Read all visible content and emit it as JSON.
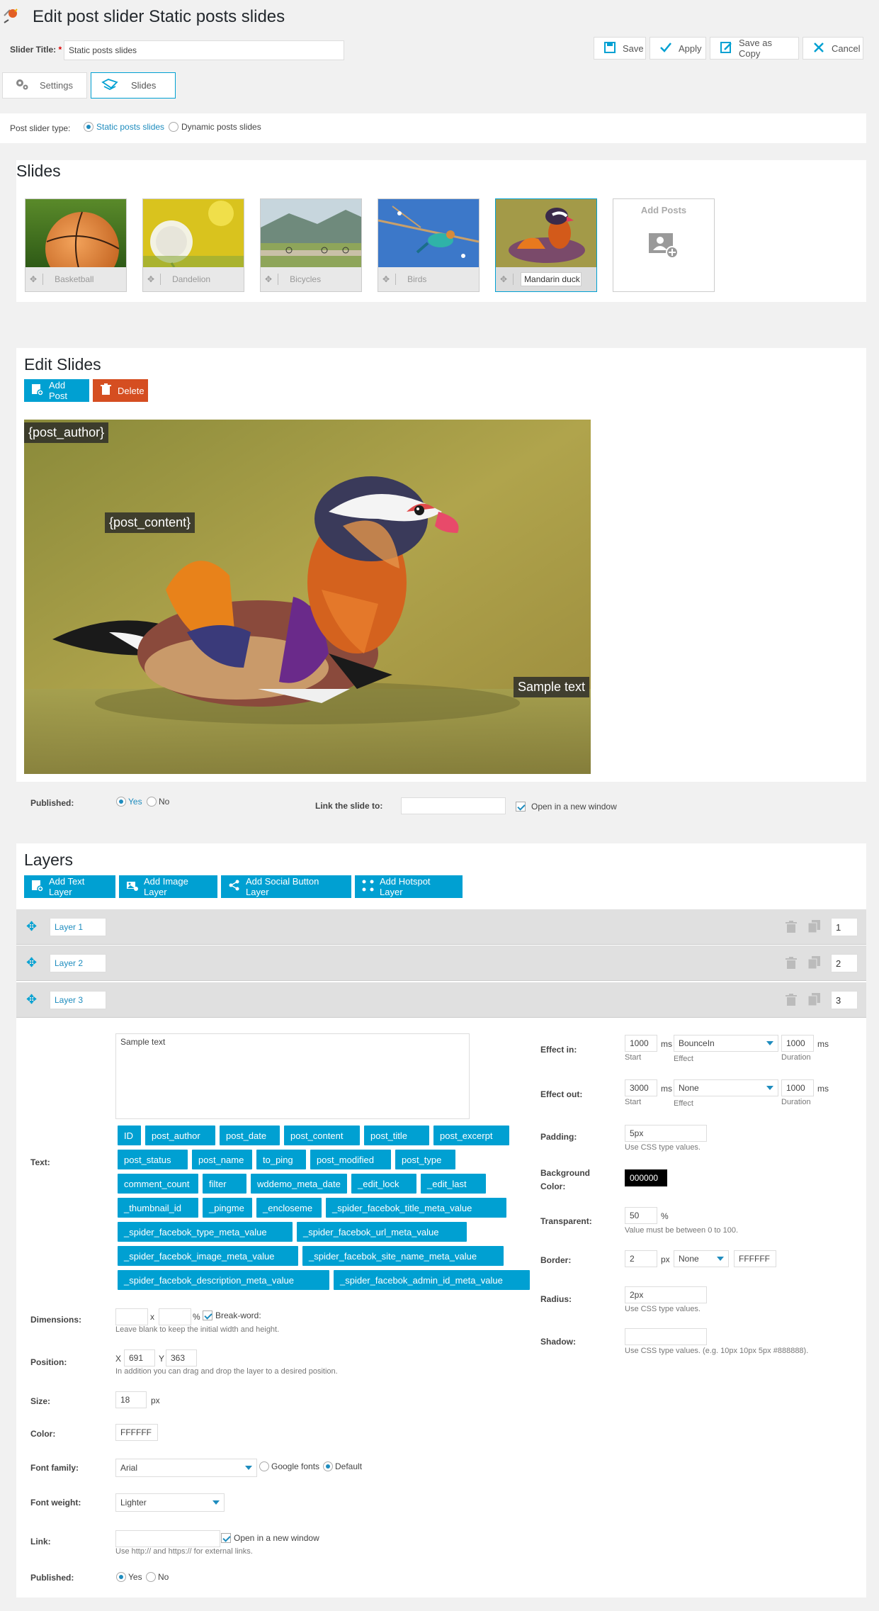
{
  "header": {
    "title": "Edit post slider Static posts slides",
    "slider_title_label": "Slider Title:",
    "required_mark": "*",
    "slider_title_value": "Static posts slides",
    "actions": {
      "save": "Save",
      "apply": "Apply",
      "save_as_copy": "Save as Copy",
      "cancel": "Cancel"
    }
  },
  "tabs": [
    {
      "label": "Settings",
      "active": false
    },
    {
      "label": "Slides",
      "active": true
    }
  ],
  "post_slider_type": {
    "label": "Post slider type:",
    "options": [
      {
        "label": "Static posts slides",
        "selected": true
      },
      {
        "label": "Dynamic posts slides",
        "selected": false
      }
    ]
  },
  "slides": {
    "heading": "Slides",
    "items": [
      {
        "title": "Basketball",
        "icon": "basketball-image",
        "active": false
      },
      {
        "title": "Dandelion",
        "icon": "dandelion-image",
        "active": false
      },
      {
        "title": "Bicycles",
        "icon": "bicycles-image",
        "active": false
      },
      {
        "title": "Birds",
        "icon": "birds-image",
        "active": false
      },
      {
        "title": "Mandarin duck",
        "icon": "duck-image",
        "active": true
      }
    ],
    "add_posts_label": "Add Posts"
  },
  "edit_slides": {
    "heading": "Edit Slides",
    "add_post_label": "Add Post",
    "delete_label": "Delete",
    "overlays": {
      "author": "{post_author}",
      "content": "{post_content}",
      "sample": "Sample text"
    },
    "published_label": "Published:",
    "yes": "Yes",
    "no": "No",
    "published": "Yes",
    "link_label": "Link the slide to:",
    "link_value": "",
    "open_new_window": "Open in a new window",
    "open_new_window_checked": true
  },
  "layers": {
    "heading": "Layers",
    "buttons": {
      "add_text": "Add Text Layer",
      "add_image": "Add Image Layer",
      "add_social": "Add Social Button Layer",
      "add_hotspot": "Add Hotspot Layer"
    },
    "list": [
      {
        "name": "Layer 1",
        "order": "1"
      },
      {
        "name": "Layer 2",
        "order": "2"
      },
      {
        "name": "Layer 3",
        "order": "3"
      }
    ]
  },
  "layer_form": {
    "text_label": "Text:",
    "text_value": "Sample text",
    "placeholder_tags": [
      "ID",
      "post_author",
      "post_date",
      "post_content",
      "post_title",
      "post_excerpt",
      "post_status",
      "post_name",
      "to_ping",
      "post_modified",
      "post_type",
      "comment_count",
      "filter",
      "wddemo_meta_date",
      "_edit_lock",
      "_edit_last",
      "_thumbnail_id",
      "_pingme",
      "_encloseme",
      "_spider_facebok_title_meta_value",
      "_spider_facebok_type_meta_value",
      "_spider_facebok_url_meta_value",
      "_spider_facebok_image_meta_value",
      "_spider_facebok_site_name_meta_value",
      "_spider_facebok_description_meta_value",
      "_spider_facebok_admin_id_meta_value"
    ],
    "dimensions_label": "Dimensions:",
    "dimensions_x_sep": "x",
    "dimensions_unit": "%",
    "break_word_label": "Break-word:",
    "break_word_checked": true,
    "dimensions_hint": "Leave blank to keep the initial width and height.",
    "position_label": "Position:",
    "pos_x_label": "X",
    "pos_x": "691",
    "pos_y_label": "Y",
    "pos_y": "363",
    "position_hint": "In addition you can drag and drop the layer to a desired position.",
    "size_label": "Size:",
    "size_value": "18",
    "size_unit": "px",
    "color_label": "Color:",
    "color_value": "FFFFFF",
    "font_family_label": "Font family:",
    "font_family_value": "Arial",
    "google_fonts_label": "Google fonts",
    "default_label": "Default",
    "font_source": "Default",
    "font_weight_label": "Font weight:",
    "font_weight_value": "Lighter",
    "link_label": "Link:",
    "link_value": "",
    "link_open_new_window": "Open in a new window",
    "link_open_checked": true,
    "link_hint": "Use http:// and https:// for external links.",
    "published_label": "Published:",
    "yes": "Yes",
    "no": "No",
    "published": "Yes",
    "effect_in_label": "Effect in:",
    "effect_in_start": "1000",
    "effect_in_effect": "BounceIn",
    "effect_in_duration": "1000",
    "effect_out_label": "Effect out:",
    "effect_out_start": "3000",
    "effect_out_effect": "None",
    "effect_out_duration": "1000",
    "ms": "ms",
    "start_caption": "Start",
    "effect_caption": "Effect",
    "duration_caption": "Duration",
    "padding_label": "Padding:",
    "padding_value": "5px",
    "css_hint": "Use CSS type values.",
    "bg_color_label_1": "Background",
    "bg_color_label_2": "Color:",
    "bg_color_value": "000000",
    "transparent_label": "Transparent:",
    "transparent_value": "50",
    "transparent_unit": "%",
    "transparent_hint": "Value must be between 0 to 100.",
    "border_label": "Border:",
    "border_width": "2",
    "border_unit": "px",
    "border_style": "None",
    "border_color": "FFFFFF",
    "radius_label": "Radius:",
    "radius_value": "2px",
    "shadow_label": "Shadow:",
    "shadow_value": "",
    "shadow_hint": "Use CSS type values. (e.g. 10px 10px 5px #888888)."
  },
  "colors": {
    "accent": "#00a0d2",
    "delete": "#d54e21",
    "link": "#1e8cbe"
  }
}
